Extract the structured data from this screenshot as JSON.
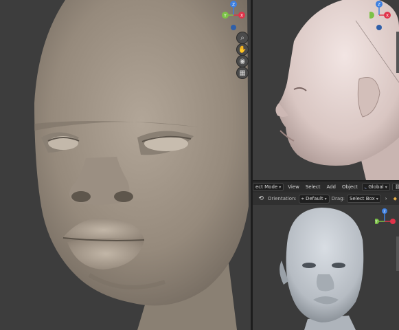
{
  "header": {
    "mode_label": "ect Mode",
    "menus": [
      "View",
      "Select",
      "Add",
      "Object"
    ],
    "transform_space": "Global"
  },
  "toolbar": {
    "orientation_label": "Orientation:",
    "orientation_value": "Default",
    "drag_label": "Drag:",
    "drag_value": "Select Box"
  },
  "gizmo_axes": {
    "z": "Z",
    "x": "X",
    "y": "Y"
  },
  "colors": {
    "axis_x": "#e0344a",
    "axis_y": "#7cc247",
    "axis_z": "#3d7fe0",
    "viewport_bg": "#3d3d3d",
    "header_bg": "#2b2b2b"
  },
  "icons": {
    "zoom": "magnifier-icon",
    "pan": "hand-icon",
    "camera": "camera-icon",
    "ortho": "grid-icon"
  }
}
